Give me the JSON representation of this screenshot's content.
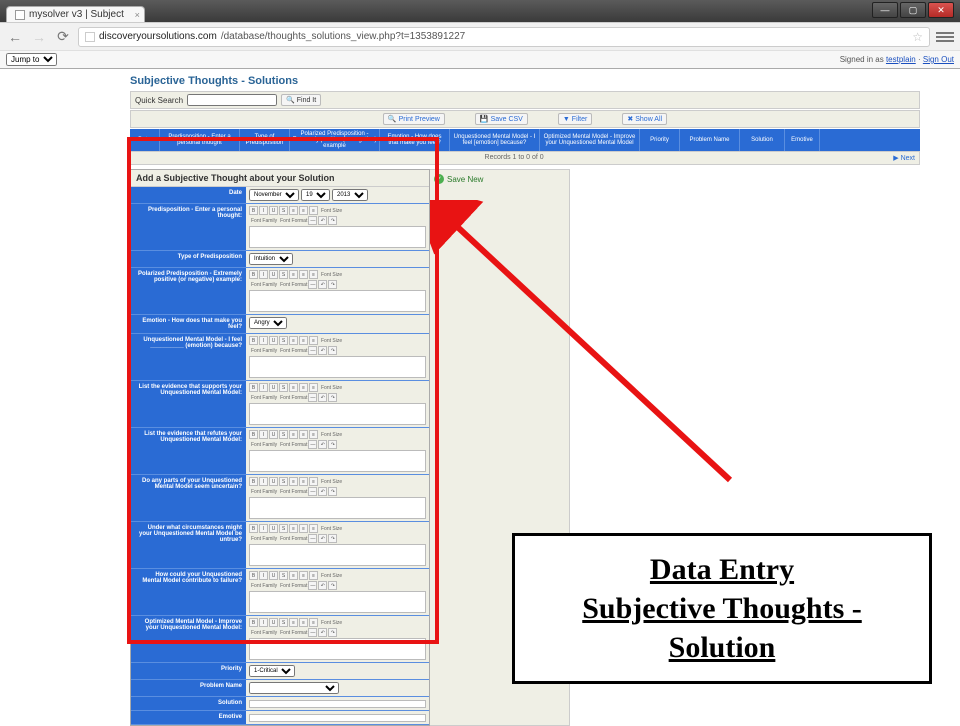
{
  "browser": {
    "tab_title": "mysolver v3 | Subject",
    "url_host": "discoveryoursolutions.com",
    "url_path": "/database/thoughts_solutions_view.php?t=1353891227",
    "jump_label": "Jump to",
    "signed_in_prefix": "Signed in as ",
    "signed_in_user": "testplain",
    "sign_out": "Sign Out"
  },
  "page": {
    "title": "Subjective Thoughts - Solutions",
    "quick_search_label": "Quick Search",
    "find_it": "Find It",
    "actions": {
      "print_preview": "Print Preview",
      "save_csv": "Save CSV",
      "filter": "Filter",
      "show_all": "Show All"
    },
    "columns": [
      "Date",
      "Predisposition - Enter a personal thought",
      "Type of Predisposition",
      "Polarized Predisposition - Extremely positive (or negative) example",
      "Emotion - How does that make you feel?",
      "Unquestioned Mental Model - I feel [emotion] because?",
      "Optimized Mental Model - Improve your Unquestioned Mental Model",
      "Priority",
      "Problem Name",
      "Solution",
      "Emotive"
    ],
    "records_text": "Records 1 to 0 of 0",
    "next": "Next"
  },
  "form": {
    "header": "Add a Subjective Thought about your Solution",
    "save_new": "Save New",
    "date": {
      "label": "Date",
      "month": "November",
      "day": "19",
      "year": "2013"
    },
    "rte": {
      "font_family": "Font Family",
      "font_format": "Font Format",
      "font_size": "Font Size"
    },
    "fields": {
      "predisposition": "Predisposition - Enter a personal thought:",
      "type_predisposition": "Type of Predisposition",
      "type_value": "Intuition",
      "polarized": "Polarized Predisposition - Extremely positive (or negative) example:",
      "emotion": "Emotion - How does that make you feel?",
      "emotion_value": "Angry",
      "umm": "Unquestioned Mental Model - I feel __________ (emotion) because?",
      "evidence_support": "List the evidence that supports your Unquestioned Mental Model:",
      "evidence_refute": "List the evidence that refutes your Unquestioned Mental Model:",
      "uncertain": "Do any parts of your Unquestioned Mental Model seem uncertain?",
      "circumstances": "Under what circumstances might your Unquestioned Mental Model be untrue?",
      "contribute_failure": "How could your Unquestioned Mental Model contribute to failure?",
      "optimized": "Optimized Mental Model - Improve your Unquestioned Mental Model:",
      "priority": "Priority",
      "priority_value": "1-Critical",
      "problem_name": "Problem Name",
      "solution": "Solution",
      "emotive": "Emotive"
    }
  },
  "annotation": {
    "line1": "Data Entry",
    "line2": "Subjective Thoughts -",
    "line3": "Solution"
  }
}
